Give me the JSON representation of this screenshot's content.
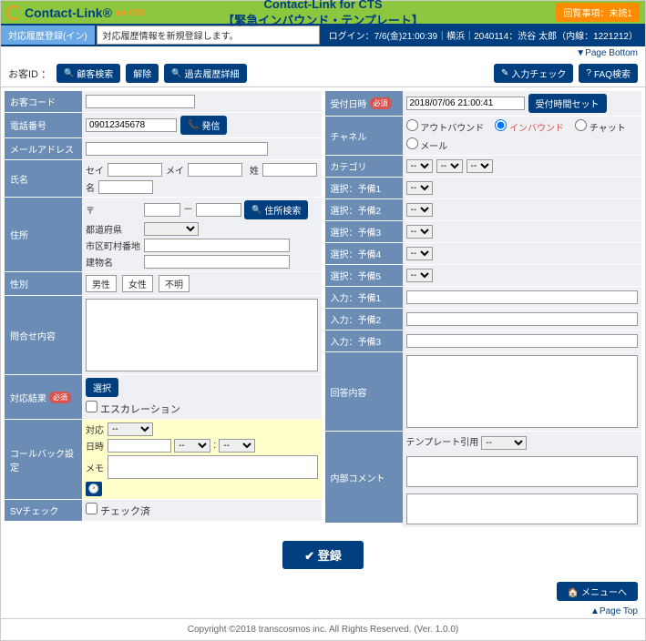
{
  "header": {
    "logo_text": "Contact-Link",
    "logo_sub": "for CTS",
    "reg_mark": "®",
    "title_line1": "Contact-Link for CTS",
    "title_line2": "【緊急インバウンド・テンプレート】",
    "notice_label": "回覧事項：未読1"
  },
  "subbar": {
    "mode": "対応履歴登録(イン)",
    "message": "対応履歴情報を新規登録します。",
    "login_info": "ログイン：7/6(金)21:00:39｜横浜｜2040114：渋谷 太郎（内線：1221212）"
  },
  "nav": {
    "page_bottom": "▼Page Bottom",
    "page_top": "▲Page Top"
  },
  "toolbar": {
    "id_label": "お客ID ：",
    "cust_search": "顧客検索",
    "clear": "解除",
    "history": "過去履歴詳細",
    "input_check": "入力チェック",
    "faq_search": "FAQ検索"
  },
  "left": {
    "cust_code": "お客コード",
    "phone": "電話番号",
    "phone_val": "09012345678",
    "call_btn": "発信",
    "email": "メールアドレス",
    "name": "氏名",
    "sei": "セイ",
    "mei": "メイ",
    "surname": "姓",
    "given": "名",
    "address": "住所",
    "postal": "〒",
    "addr_search": "住所検索",
    "pref": "都道府県",
    "city": "市区町村番地",
    "bldg": "建物名",
    "gender": "性別",
    "male": "男性",
    "female": "女性",
    "unknown": "不明",
    "inquiry": "問合せ内容",
    "result": "対応結果",
    "select": "選択",
    "escalation": "エスカレーション",
    "callback": "コールバック設定",
    "cb_taiou": "対応",
    "cb_date": "日時",
    "cb_memo": "メモ",
    "sv": "SVチェック",
    "sv_checked": "チェック済"
  },
  "right": {
    "recv": "受付日時",
    "recv_val": "2018/07/06 21:00:41",
    "recv_btn": "受付時間セット",
    "channel": "チャネル",
    "ch_out": "アウトバウンド",
    "ch_in": "インバウンド",
    "ch_chat": "チャット",
    "ch_mail": "メール",
    "category": "カテゴリ",
    "sel1": "選択：予備1",
    "sel2": "選択：予備2",
    "sel3": "選択：予備3",
    "sel4": "選択：予備4",
    "sel5": "選択：予備5",
    "inp1": "入力：予備1",
    "inp2": "入力：予備2",
    "inp3": "入力：予備3",
    "answer": "回答内容",
    "template": "テンプレート引用",
    "internal": "内部コメント"
  },
  "actions": {
    "register": "登録",
    "menu": "メニューへ"
  },
  "footer": {
    "copyright": "Copyright ©2018 transcosmos inc. All Rights Reserved. (Ver. 1.0.0)"
  },
  "badges": {
    "required": "必須"
  }
}
